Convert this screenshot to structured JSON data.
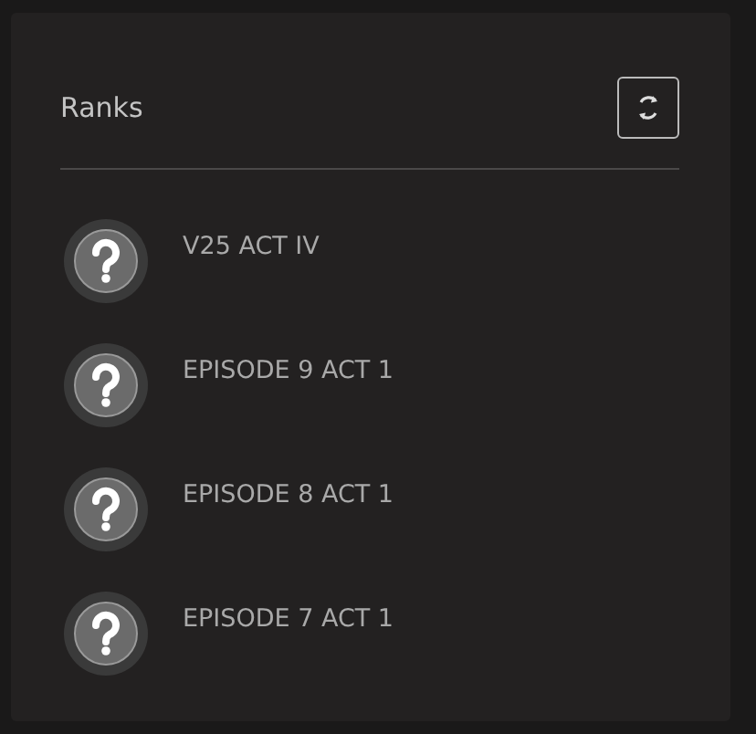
{
  "panel": {
    "title": "Ranks"
  },
  "ranks": [
    {
      "name": "V25 ACT IV"
    },
    {
      "name": "EPISODE 9 ACT 1"
    },
    {
      "name": "EPISODE 8 ACT 1"
    },
    {
      "name": "EPISODE 7 ACT 1"
    }
  ]
}
